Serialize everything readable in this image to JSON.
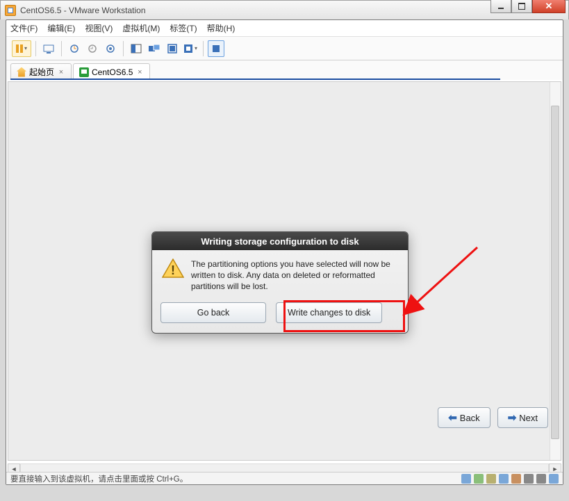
{
  "titlebar": {
    "title": "CentOS6.5 - VMware Workstation"
  },
  "menu": {
    "file": "文件(F)",
    "edit": "编辑(E)",
    "view": "视图(V)",
    "vm": "虚拟机(M)",
    "tabs": "标签(T)",
    "help": "帮助(H)"
  },
  "tabs": {
    "home": "起始页",
    "vm": "CentOS6.5"
  },
  "dialog": {
    "title": "Writing storage configuration to disk",
    "body": "The partitioning options you have selected will now be written to disk.  Any data on deleted or reformatted partitions will be lost.",
    "go_back": "Go back",
    "write": "Write changes to disk"
  },
  "nav": {
    "back": "Back",
    "next": "Next"
  },
  "status": {
    "hint": "要直接输入到该虚拟机，请点击里面或按 Ctrl+G。"
  }
}
